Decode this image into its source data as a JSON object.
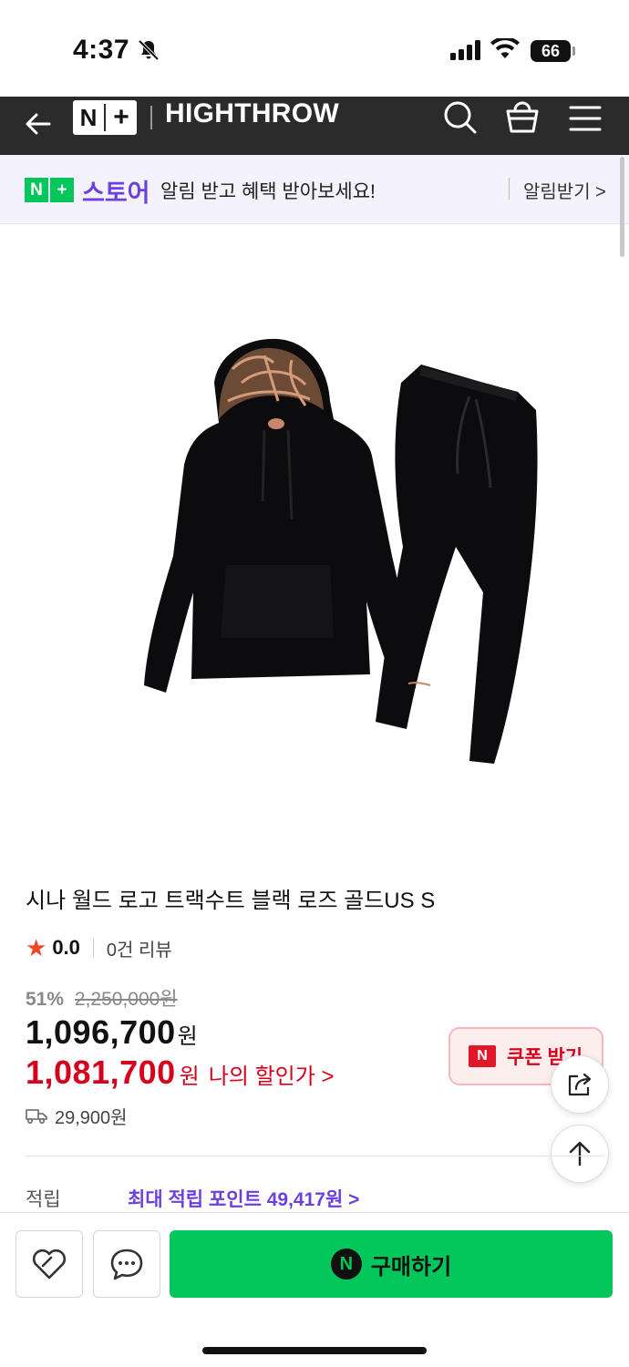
{
  "status_bar": {
    "time": "4:37",
    "battery": "66",
    "icons": [
      "bell-slash-icon",
      "cellular-signal-icon",
      "wifi-icon",
      "battery-icon"
    ]
  },
  "header": {
    "logo_n": "N",
    "logo_plus": "+",
    "store_name": "HIGHTHROW",
    "icons": [
      "back-arrow-icon",
      "search-icon",
      "shopping-bag-icon",
      "menu-icon"
    ],
    "background": "#2b2b2b"
  },
  "promo": {
    "badge_n": "N",
    "badge_plus": "+",
    "store": "스토어",
    "message": "알림 받고 혜택 받아보세요!",
    "action": "알림받기 >",
    "brand_green": "#03c75a",
    "brand_purple": "#6c3fe0"
  },
  "product": {
    "title": "시나 월드 로고 트랙수트 블랙 로즈 골드US S",
    "rating": "0.0",
    "reviews": "0건 리뷰",
    "discount_pct": "51%",
    "original_price": "2,250,000원",
    "price": "1,096,700",
    "price_unit": "원",
    "my_price": "1,081,700",
    "my_price_unit": "원",
    "my_price_link": "나의 할인가 >",
    "coupon_badge": "N",
    "coupon_label": "쿠폰 받기",
    "shipping": "29,900원",
    "points_label": "적립",
    "points_value": "최대 적립 포인트 49,417원 >",
    "image": "black-tracksuit-hoodie-and-pants-image",
    "sale_red": "#d5001c"
  },
  "floating": {
    "share_icon": "share-icon",
    "top_icon": "arrow-up-icon"
  },
  "bottom_bar": {
    "like_icon": "heart-icon",
    "chat_icon": "chat-bubble-icon",
    "buy_n": "N",
    "buy_label": "구매하기"
  }
}
